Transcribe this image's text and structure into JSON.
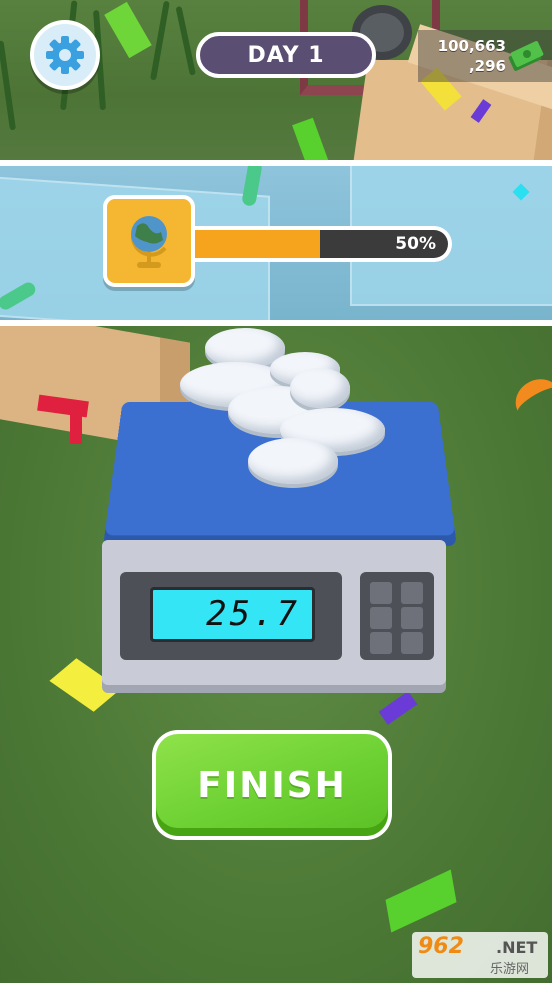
{
  "header": {
    "day_label": "DAY 1",
    "money_line1": "100,663",
    "money_line2": ",296"
  },
  "progress": {
    "label": "50%",
    "fraction": 0.5,
    "icon": "globe-icon"
  },
  "scale": {
    "reading": "25.7"
  },
  "finish_button": {
    "label": "FINISH"
  },
  "watermark": {
    "main": "962",
    "net": ".NET",
    "sub": "乐游网"
  },
  "colors": {
    "progress_fill": "#f6a31d",
    "finish_green": "#6dd133",
    "scale_blue": "#3b6fd0",
    "lcd_cyan": "#34e6f5"
  }
}
